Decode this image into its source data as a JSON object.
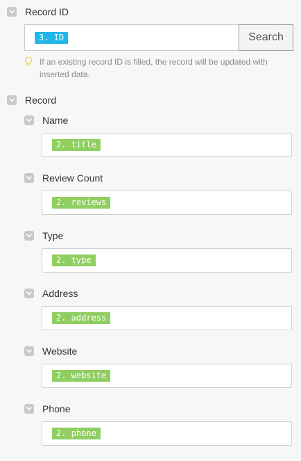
{
  "record_id": {
    "label": "Record ID",
    "input_pill": "3. ID",
    "search_label": "Search",
    "hint": "If an existing record ID is filled, the record will be updated with inserted data."
  },
  "record": {
    "label": "Record",
    "fields": [
      {
        "label": "Name",
        "pill": "2. title"
      },
      {
        "label": "Review Count",
        "pill": "2. reviews"
      },
      {
        "label": "Type",
        "pill": "2. type"
      },
      {
        "label": "Address",
        "pill": "2. address"
      },
      {
        "label": "Website",
        "pill": "2. website"
      },
      {
        "label": "Phone",
        "pill": "2. phone"
      }
    ]
  },
  "colors": {
    "pill_blue": "#1fb7ea",
    "pill_green": "#8fce60",
    "hint_bulb": "#f2c94c"
  },
  "icons": {
    "toggle": "chevron-down-icon",
    "hint": "lightbulb-icon"
  }
}
